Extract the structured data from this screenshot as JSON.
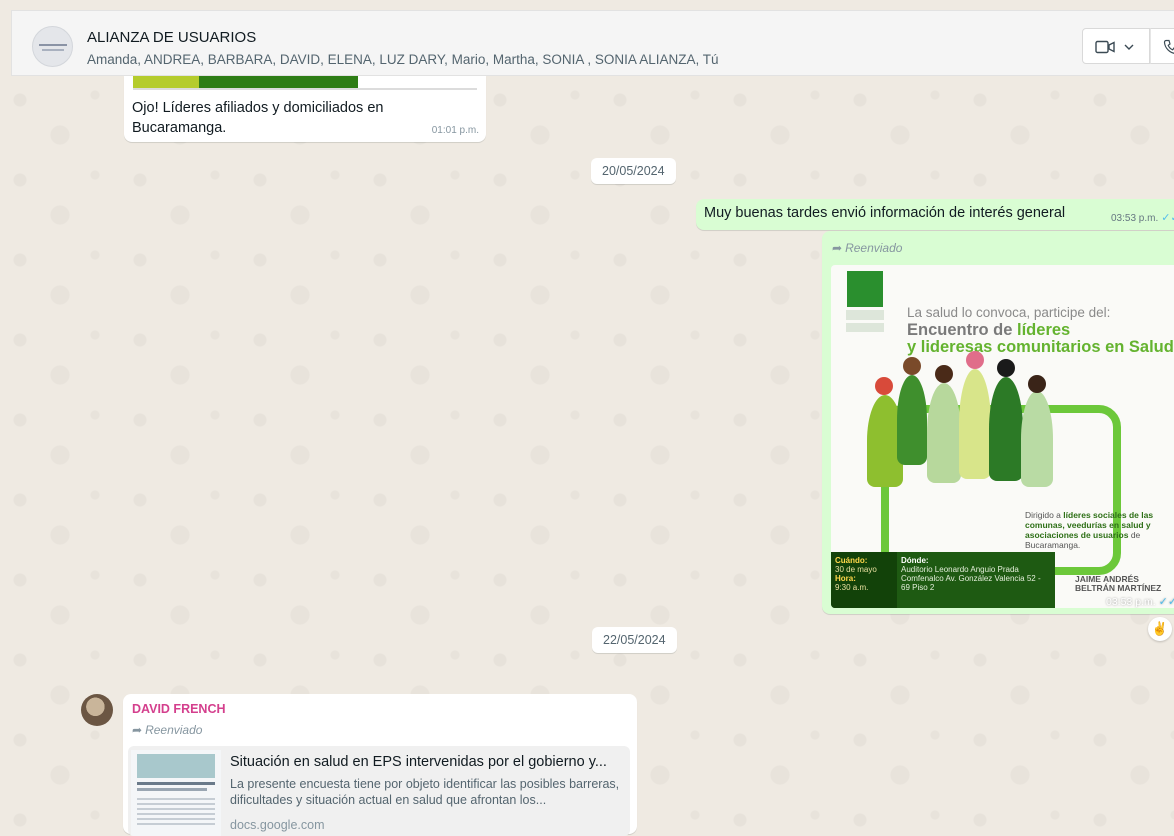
{
  "header": {
    "title": "ALIANZA DE USUARIOS",
    "members": "Amanda, ANDREA, BARBARA, DAVID, ELENA, LUZ DARY, Mario, Martha, SONIA , SONIA ALIANZA, Tú"
  },
  "messages": {
    "m1": {
      "text": "Ojo! Líderes afiliados y domiciliados en Bucaramanga.",
      "time": "01:01 p.m."
    },
    "date1": "20/05/2024",
    "m2": {
      "text": "Muy buenas tardes envió información de interés general",
      "time": "03:53 p.m."
    },
    "m3": {
      "forwarded_label": "Reenviado",
      "time": "03:53 p.m.",
      "poster": {
        "invite": "La salud lo convoca, participe del:",
        "title_line1_a": "Encuentro de ",
        "title_line1_b": "líderes",
        "title_line2": "y lideresas comunitarios en Salud",
        "dirigido_a": "Dirigido a ",
        "dirigido_b": "líderes sociales de las comunas, veedurías en salud y asociaciones de usuarios",
        "dirigido_c": " de Bucaramanga.",
        "cuando_label": "Cuándo:",
        "cuando_value": "30 de mayo",
        "hora_label": "Hora:",
        "hora_value": "9:30 a.m.",
        "donde_label": "Dónde:",
        "donde_value": "Auditorio Leonardo Anguio Prada Comfenalco Av. González Valencia 52 - 69 Piso 2",
        "name_line1": "JAIME ANDRÉS",
        "name_line2": "BELTRÁN MARTÍNEZ"
      },
      "reaction": "✌"
    },
    "date2": "22/05/2024",
    "m4": {
      "sender": "DAVID FRENCH",
      "forwarded_label": "Reenviado",
      "link": {
        "title": "Situación en salud en EPS intervenidas por el gobierno y...",
        "description": "La presente encuesta tiene por objeto identificar las posibles barreras, dificultades y situación actual en salud que afrontan los...",
        "domain": "docs.google.com"
      }
    }
  },
  "colors": {
    "outgoing_bubble": "#d9fdd3",
    "incoming_bubble": "#ffffff",
    "sender_name": "#d43f8d",
    "read_tick": "#53bdeb",
    "poster_green": "#64b32f"
  },
  "icons": {
    "video": "video-call-icon",
    "chevron": "chevron-down-icon",
    "phone": "phone-icon",
    "forward": "forward-arrow-icon",
    "ticks": "double-check-icon"
  }
}
